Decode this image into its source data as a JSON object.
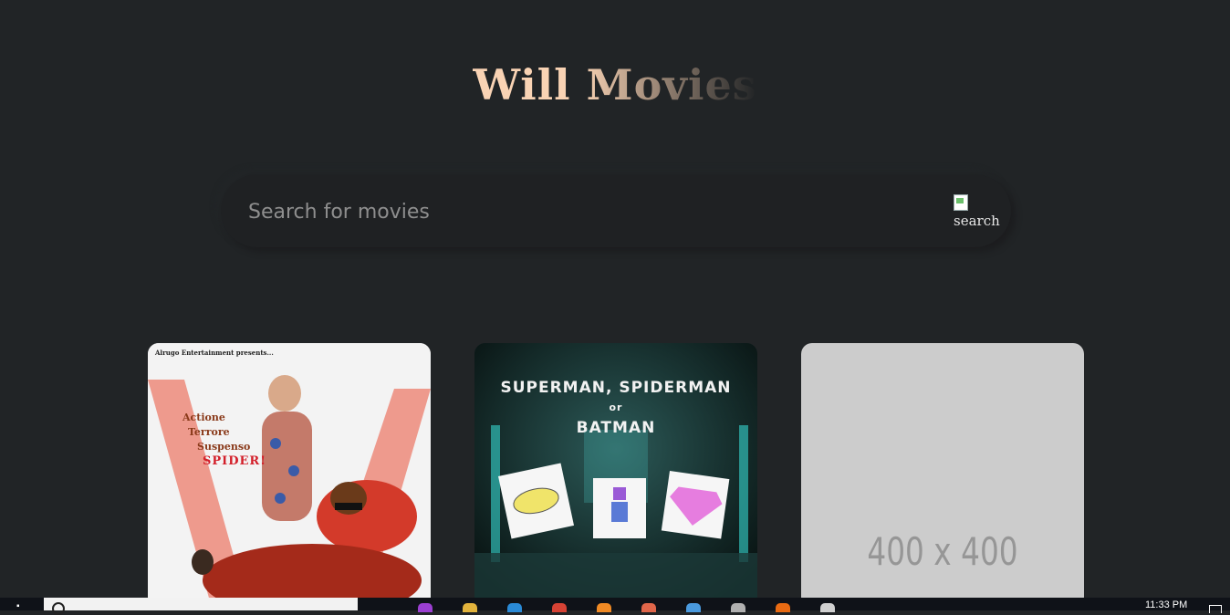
{
  "app": {
    "title": "Will Movies"
  },
  "search": {
    "placeholder": "Search for movies",
    "icon_alt": "search",
    "icon": "broken-image-icon"
  },
  "movies": [
    {
      "poster_text": {
        "top": "Alrugo Entertainment presents...",
        "line1": "Actione",
        "line2": "Terrore",
        "line3": "Suspenso",
        "title": "SPIDER!"
      },
      "palette": [
        "#f3f3f3",
        "#e87a6a",
        "#d31f2a"
      ]
    },
    {
      "poster_text": {
        "line1": "SUPERMAN, SPIDERMAN",
        "line2": "or",
        "line3": "BATMAN"
      },
      "palette": [
        "#0d2322",
        "#2fc4c0",
        "#f2f2f2"
      ]
    },
    {
      "placeholder": "400 x 400",
      "palette": [
        "#cccccc",
        "#969696"
      ]
    }
  ],
  "taskbar": {
    "time": "11:33 PM",
    "apps": [
      {
        "icon": "podcast-app-icon",
        "color": "#9b3fd1"
      },
      {
        "icon": "folder-icon",
        "color": "#e2b33c"
      },
      {
        "icon": "vscode-icon",
        "color": "#2a8ad6"
      },
      {
        "icon": "chrome-icon",
        "color": "#d64234"
      },
      {
        "icon": "sublime-icon",
        "color": "#f08a24"
      },
      {
        "icon": "git-icon",
        "color": "#e0664a"
      },
      {
        "icon": "app-window-icon",
        "color": "#4a9ade"
      },
      {
        "icon": "notes-icon",
        "color": "#b0b0b0"
      },
      {
        "icon": "firefox-icon",
        "color": "#e86a12"
      },
      {
        "icon": "settings-icon",
        "color": "#d0d0d0"
      }
    ]
  },
  "colors": {
    "background": "#212426",
    "title_gradient_start": "#f9d3b4",
    "search_bg": "#1f2123"
  }
}
